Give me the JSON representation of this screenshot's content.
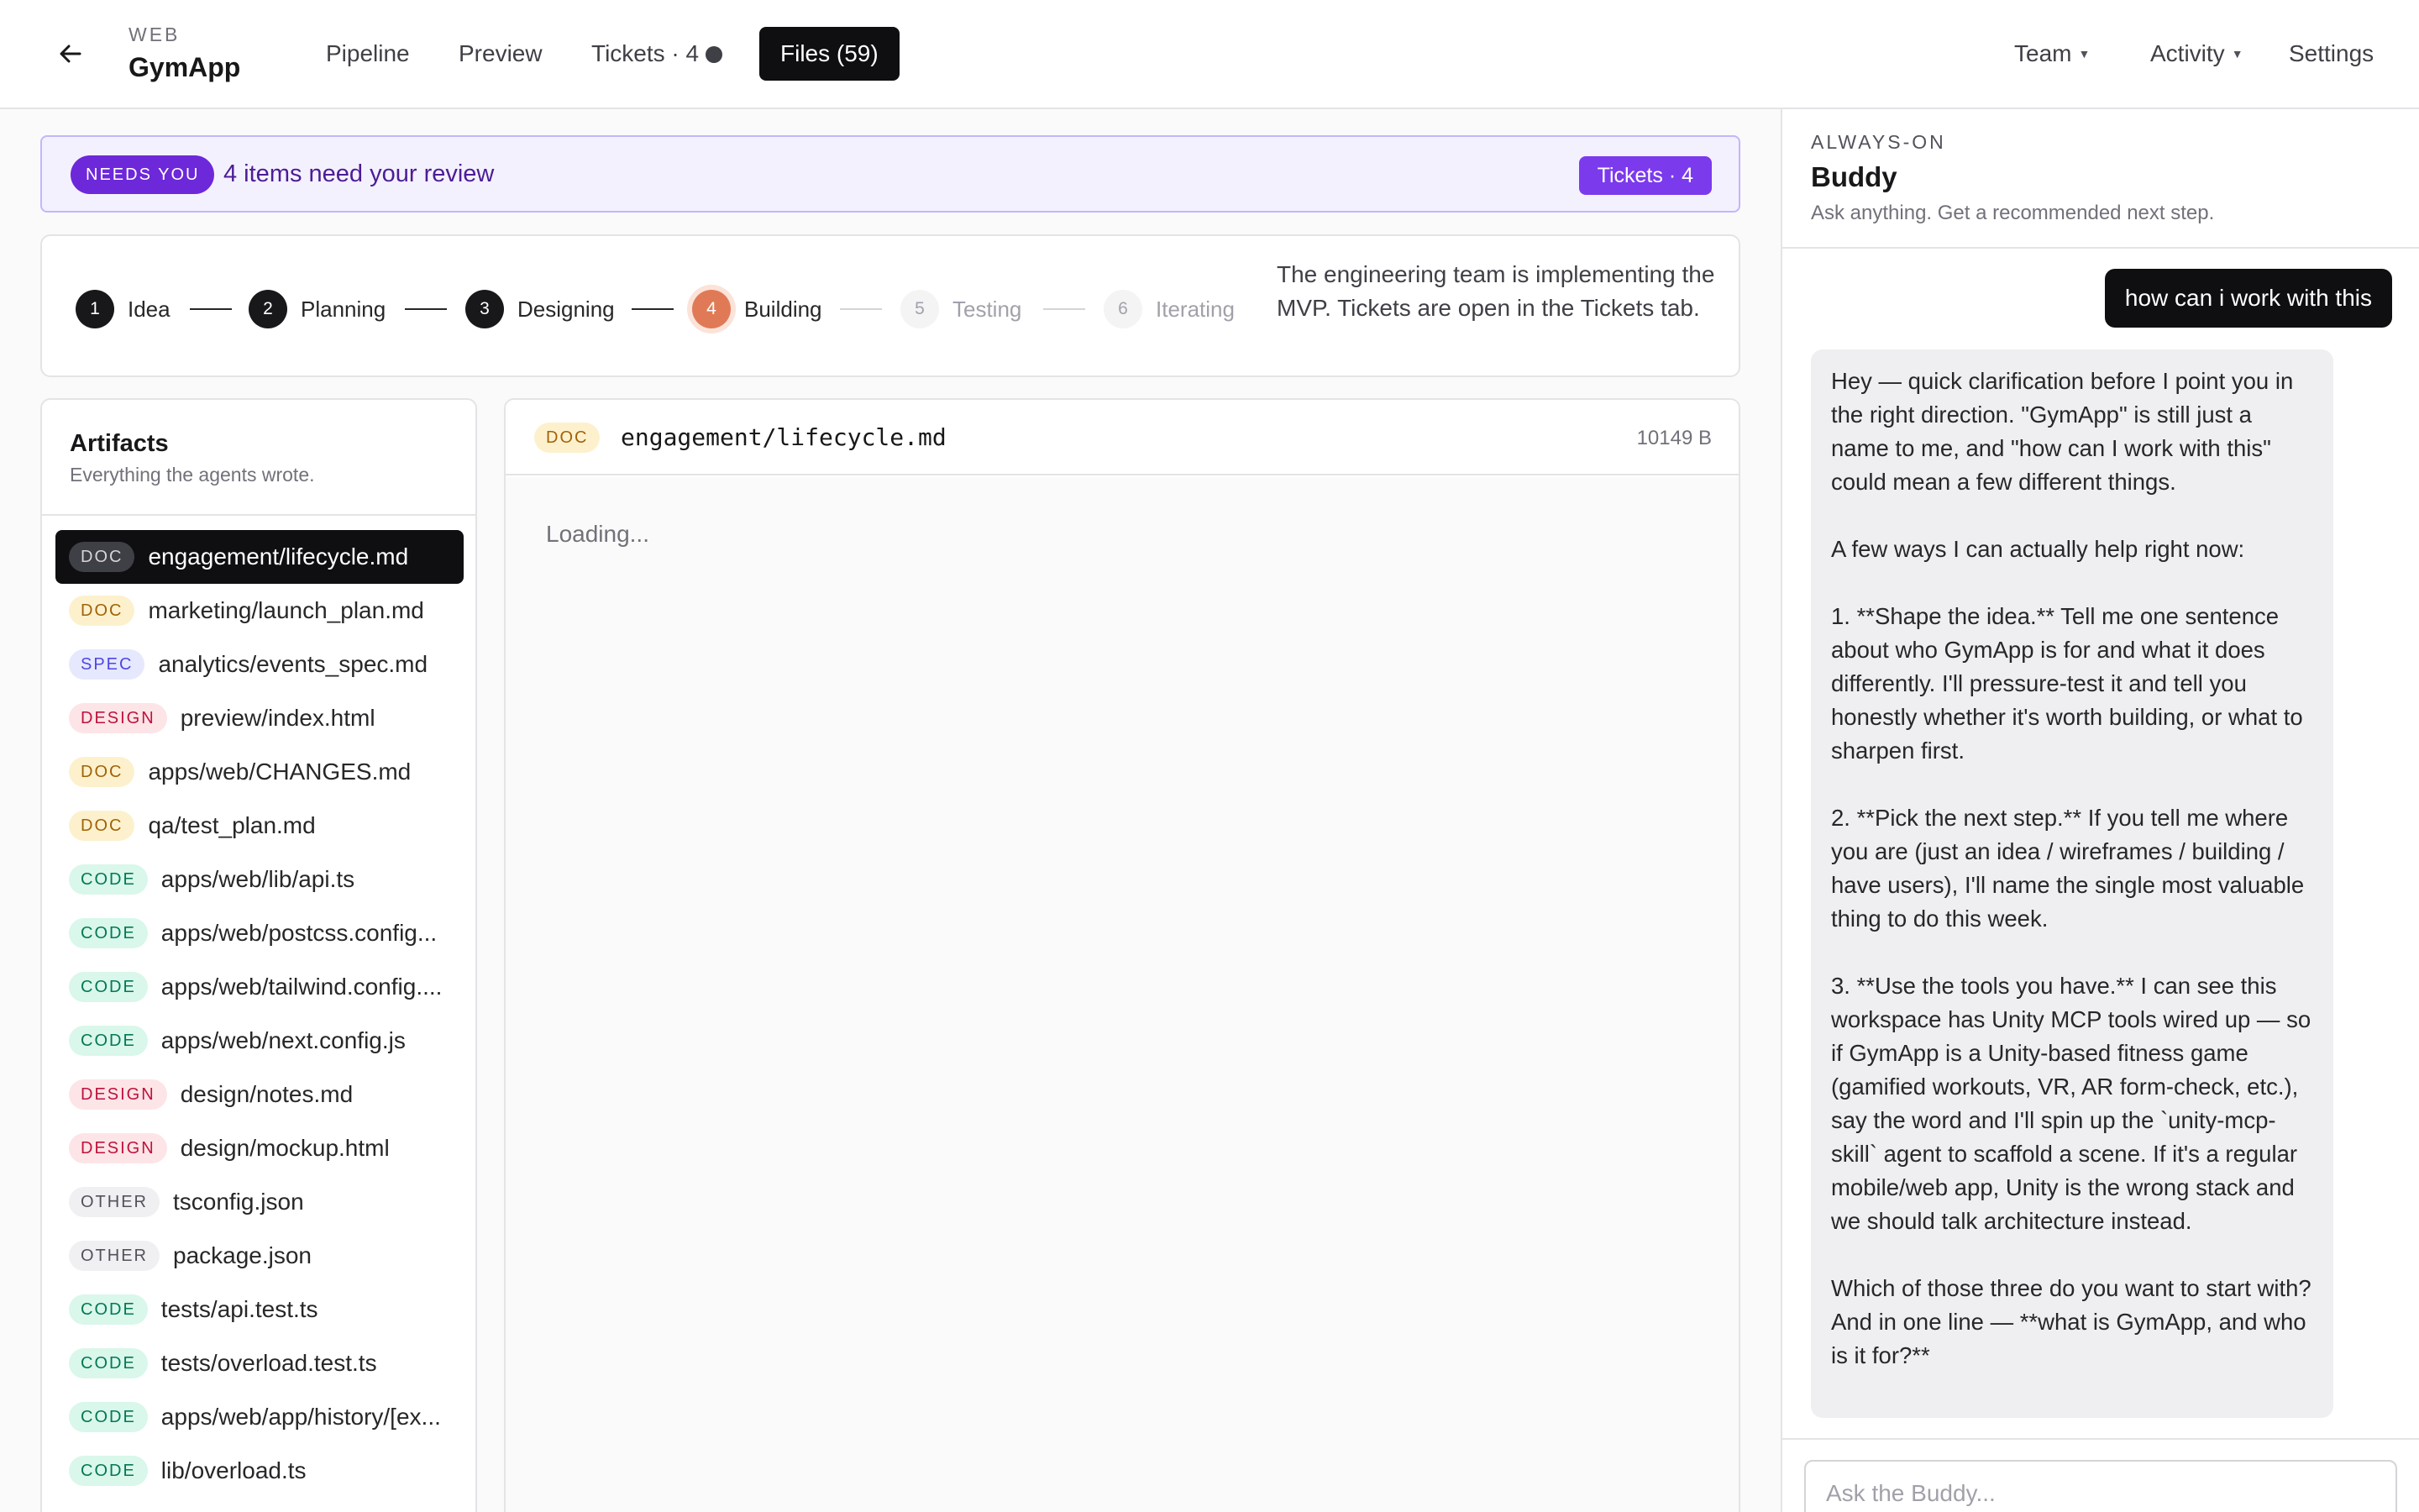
{
  "header": {
    "project_kicker": "WEB",
    "project_name": "GymApp",
    "nav": {
      "pipeline": "Pipeline",
      "preview": "Preview",
      "tickets": "Tickets · 4",
      "files": "Files (59)"
    },
    "right": {
      "team": "Team",
      "activity": "Activity",
      "settings": "Settings"
    }
  },
  "review_banner": {
    "pill": "NEEDS YOU",
    "text": "4 items need your review",
    "button": "Tickets · 4"
  },
  "stepper": {
    "steps": [
      {
        "num": "1",
        "label": "Idea",
        "state": "done"
      },
      {
        "num": "2",
        "label": "Planning",
        "state": "done"
      },
      {
        "num": "3",
        "label": "Designing",
        "state": "done"
      },
      {
        "num": "4",
        "label": "Building",
        "state": "current"
      },
      {
        "num": "5",
        "label": "Testing",
        "state": "future"
      },
      {
        "num": "6",
        "label": "Iterating",
        "state": "future"
      }
    ],
    "description": "The engineering team is implementing the MVP. Tickets are open in the Tickets tab."
  },
  "artifacts": {
    "title": "Artifacts",
    "subtitle": "Everything the agents wrote.",
    "files": [
      {
        "tag": "DOC",
        "name": "engagement/lifecycle.md",
        "active": true
      },
      {
        "tag": "DOC",
        "name": "marketing/launch_plan.md"
      },
      {
        "tag": "SPEC",
        "name": "analytics/events_spec.md"
      },
      {
        "tag": "DESIGN",
        "name": "preview/index.html"
      },
      {
        "tag": "DOC",
        "name": "apps/web/CHANGES.md"
      },
      {
        "tag": "DOC",
        "name": "qa/test_plan.md"
      },
      {
        "tag": "CODE",
        "name": "apps/web/lib/api.ts"
      },
      {
        "tag": "CODE",
        "name": "apps/web/postcss.config..."
      },
      {
        "tag": "CODE",
        "name": "apps/web/tailwind.config...."
      },
      {
        "tag": "CODE",
        "name": "apps/web/next.config.js"
      },
      {
        "tag": "DESIGN",
        "name": "design/notes.md"
      },
      {
        "tag": "DESIGN",
        "name": "design/mockup.html"
      },
      {
        "tag": "OTHER",
        "name": "tsconfig.json"
      },
      {
        "tag": "OTHER",
        "name": "package.json"
      },
      {
        "tag": "CODE",
        "name": "tests/api.test.ts"
      },
      {
        "tag": "CODE",
        "name": "tests/overload.test.ts"
      },
      {
        "tag": "CODE",
        "name": "apps/web/app/history/[ex..."
      },
      {
        "tag": "CODE",
        "name": "lib/overload.ts"
      }
    ]
  },
  "viewer": {
    "tag": "DOC",
    "path": "engagement/lifecycle.md",
    "size": "10149 B",
    "loading": "Loading..."
  },
  "buddy": {
    "kicker": "ALWAYS-ON",
    "name": "Buddy",
    "subtitle": "Ask anything. Get a recommended next step.",
    "user_message": "how can i work with this",
    "bot_message": "Hey — quick clarification before I point you in the right direction. \"GymApp\" is still just a name to me, and \"how can I work with this\" could mean a few different things.\n\nA few ways I can actually help right now:\n\n1. **Shape the idea.** Tell me one sentence about who GymApp is for and what it does differently. I'll pressure-test it and tell you honestly whether it's worth building, or what to sharpen first.\n\n2. **Pick the next step.** If you tell me where you are (just an idea / wireframes / building / have users), I'll name the single most valuable thing to do this week.\n\n3. **Use the tools you have.** I can see this workspace has Unity MCP tools wired up — so if GymApp is a Unity-based fitness game (gamified workouts, VR, AR form-check, etc.), say the word and I'll spin up the `unity-mcp-skill` agent to scaffold a scene. If it's a regular mobile/web app, Unity is the wrong stack and we should talk architecture instead.\n\nWhich of those three do you want to start with? And in one line — **what is GymApp, and who is it for?**",
    "input_placeholder": "Ask the Buddy..."
  }
}
